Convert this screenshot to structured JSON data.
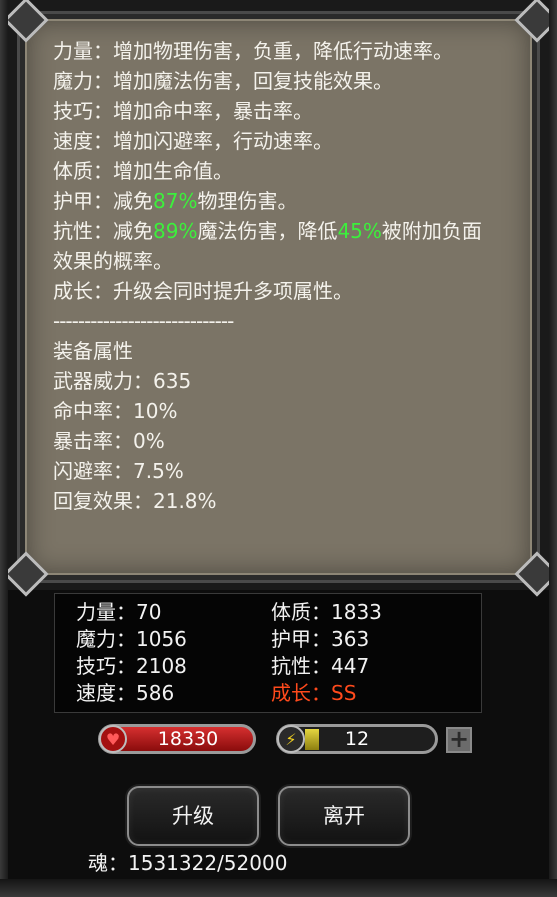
{
  "tooltip": {
    "lines": [
      {
        "parts": [
          {
            "t": "力量：增加物理伤害，负重，降低行动速率。"
          }
        ]
      },
      {
        "parts": [
          {
            "t": "魔力：增加魔法伤害，回复技能效果。"
          }
        ]
      },
      {
        "parts": [
          {
            "t": "技巧：增加命中率，暴击率。"
          }
        ]
      },
      {
        "parts": [
          {
            "t": "速度：增加闪避率，行动速率。"
          }
        ]
      },
      {
        "parts": [
          {
            "t": "体质：增加生命值。"
          }
        ]
      }
    ],
    "armor_prefix": "护甲：减免",
    "armor_value": "87%",
    "armor_suffix": "物理伤害。",
    "resist_prefix": "抗性：减免",
    "resist_value": "89%",
    "resist_mid": "魔法伤害，降低",
    "resist_value2": "45%",
    "resist_suffix": "被附加负面效果的概率。",
    "growth_line": "成长：升级会同时提升多项属性。",
    "separator": "-----------------------------",
    "equip_title": "装备属性",
    "equip_lines": [
      "武器威力：635",
      "命中率：10%",
      "暴击率：0%",
      "闪避率：7.5%",
      "回复效果：21.8%"
    ]
  },
  "stats": {
    "strength": "力量：70",
    "magic": "魔力：1056",
    "skill": "技巧：2108",
    "speed": "速度：586",
    "constitution": "体质：1833",
    "armor": "护甲：363",
    "resistance": "抗性：447",
    "growth": "成长：SS"
  },
  "hp": {
    "value": "18330",
    "icon": "heart-icon"
  },
  "energy": {
    "value": "12",
    "icon": "lightning-icon",
    "fill_fraction": 0.1
  },
  "buttons": {
    "upgrade": "升级",
    "leave": "离开",
    "plus": "+"
  },
  "soul": "魂：1531322/52000",
  "colors": {
    "highlight_green": "#3cf03c",
    "growth_orange": "#ff4a1c",
    "panel": "#7b7466"
  }
}
